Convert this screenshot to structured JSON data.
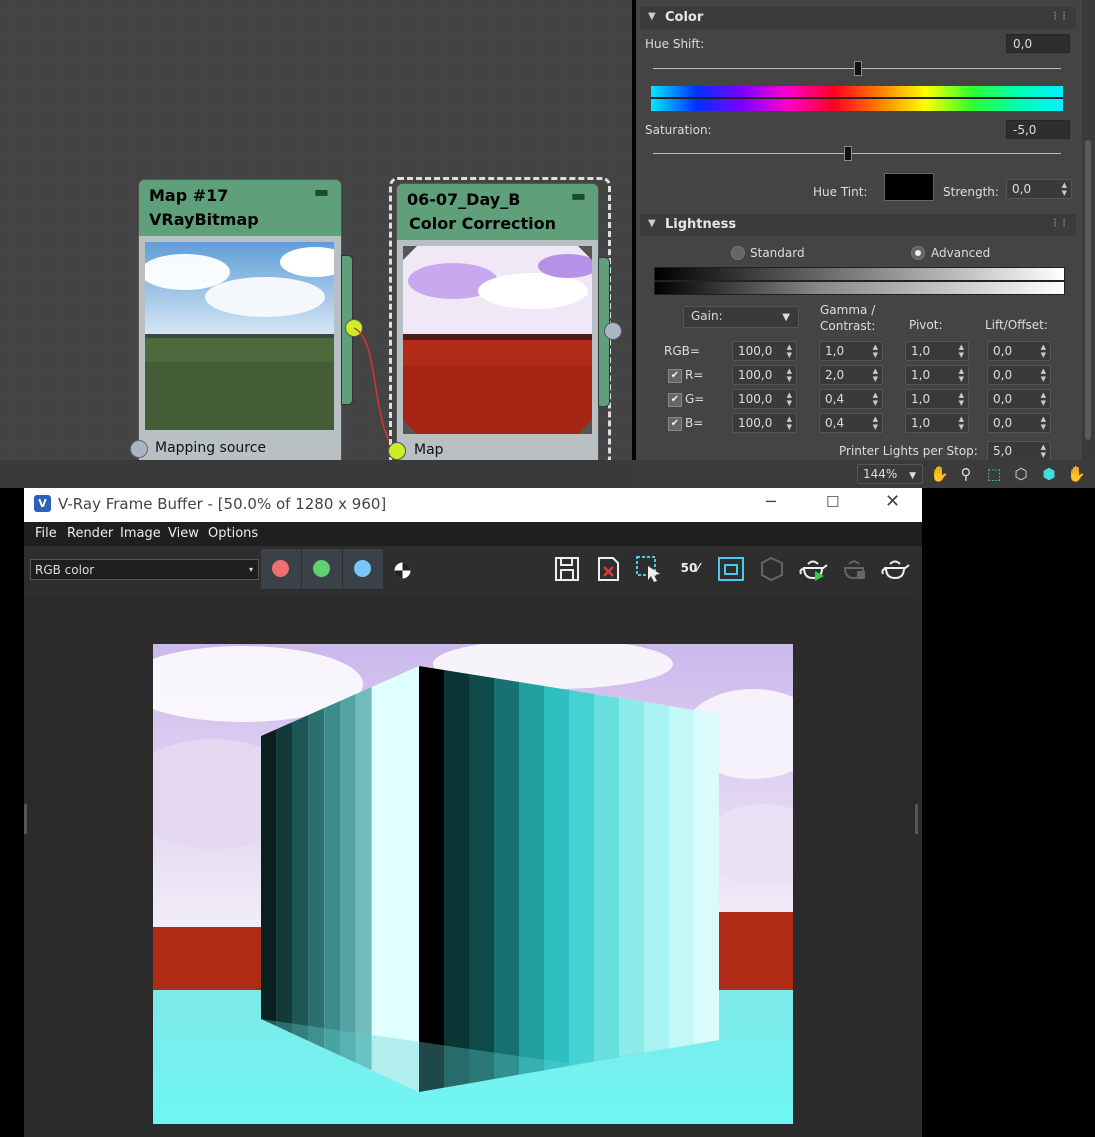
{
  "slate": {
    "node1": {
      "title_line1": "Map #17",
      "title_line2": "VRayBitmap",
      "port": "Mapping source"
    },
    "node2": {
      "title_line1": "06-07_Day_B",
      "title_line2": "Color Correction",
      "port": "Map"
    }
  },
  "panel": {
    "color_rollout": {
      "title": "Color",
      "hue_shift_label": "Hue Shift:",
      "hue_shift_value": "0,0",
      "saturation_label": "Saturation:",
      "saturation_value": "-5,0",
      "hue_tint_label": "Hue Tint:",
      "hue_tint_color": "#000000",
      "strength_label": "Strength:",
      "strength_value": "0,0"
    },
    "lightness_rollout": {
      "title": "Lightness",
      "mode_standard": "Standard",
      "mode_advanced": "Advanced",
      "gain_dropdown": "Gain:",
      "col_gamma": "Gamma /\nContrast:",
      "col_pivot": "Pivot:",
      "col_lift": "Lift/Offset:",
      "rows": [
        {
          "label": "RGB=",
          "gain": "100,0",
          "gamma": "1,0",
          "pivot": "1,0",
          "lift": "0,0"
        },
        {
          "label": "R=",
          "gain": "100,0",
          "gamma": "2,0",
          "pivot": "1,0",
          "lift": "0,0"
        },
        {
          "label": "G=",
          "gain": "100,0",
          "gamma": "0,4",
          "pivot": "1,0",
          "lift": "0,0"
        },
        {
          "label": "B=",
          "gain": "100,0",
          "gamma": "0,4",
          "pivot": "1,0",
          "lift": "0,0"
        }
      ],
      "printer_label": "Printer Lights per Stop:",
      "printer_value": "5,0"
    },
    "zoom": "144%"
  },
  "vfb": {
    "title": "V-Ray Frame Buffer - [50.0% of 1280 x 960]",
    "menu": [
      "File",
      "Render",
      "Image",
      "View",
      "Options"
    ],
    "channel": "RGB color",
    "zoom_badge": "50"
  }
}
